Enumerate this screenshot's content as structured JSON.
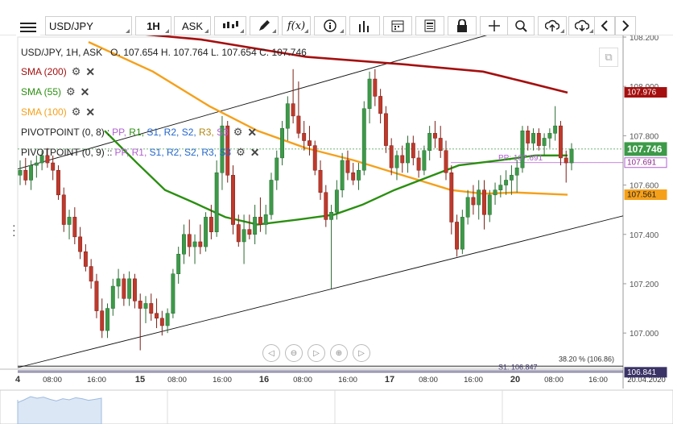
{
  "toolbar": {
    "menu_icon": "hamburger-icon",
    "symbol": "USD/JPY",
    "timeframe": "1H",
    "price_side": "ASK",
    "tools": [
      "candles-icon",
      "pencil-icon",
      "fx-icon",
      "info-icon",
      "bars-icon",
      "calendar-icon",
      "news-icon",
      "lock-icon",
      "crosshair-icon",
      "zoom-icon",
      "upload-icon",
      "download-icon",
      "chevron-left-icon",
      "chevron-right-icon"
    ]
  },
  "header": {
    "symbol_line": "USD/JPY, 1H, ASK",
    "o_label": "O.",
    "o_value": "107.654",
    "h_label": "H.",
    "h_value": "107.764",
    "l_label": "L.",
    "l_value": "107.654",
    "c_label": "C.",
    "c_value": "107.746"
  },
  "indicators": [
    {
      "label": "SMA (200)",
      "color": "#a50f0f"
    },
    {
      "label": "SMA (55)",
      "color": "#2a8f10"
    },
    {
      "label": "SMA (100)",
      "color": "#f5a01a"
    }
  ],
  "pivots": [
    {
      "label": "PIVOTPOINT (0, 8)",
      "sep": ":",
      "levels": [
        {
          "t": "PP",
          "c": "#b05fd0"
        },
        {
          "t": "R1",
          "c": "#2a8f10"
        },
        {
          "t": "S1",
          "c": "#2266cc"
        },
        {
          "t": "R2",
          "c": "#2266cc"
        },
        {
          "t": "S2",
          "c": "#2266cc"
        },
        {
          "t": "R3",
          "c": "#b08810"
        },
        {
          "t": "S3",
          "c": "#b05fd0"
        }
      ]
    },
    {
      "label": "PIVOTPOINT (0, 9)",
      "sep": "::",
      "levels": [
        {
          "t": "PP",
          "c": "#b05fd0"
        },
        {
          "t": "R1",
          "c": "#b05fd0"
        },
        {
          "t": "S1",
          "c": "#2266cc"
        },
        {
          "t": "R2",
          "c": "#2266cc"
        },
        {
          "t": "S2",
          "c": "#2266cc"
        },
        {
          "t": "R3",
          "c": "#2266cc"
        },
        {
          "t": "S3",
          "c": "#2266cc"
        }
      ]
    }
  ],
  "colors": {
    "bull": "#3c9a48",
    "bear": "#c0392b",
    "sma200": "#a50f0f",
    "sma55": "#2a8f10",
    "sma100": "#f5a01a",
    "pivot": "#b05fd0"
  },
  "chart_data": {
    "type": "candlestick",
    "symbol": "USD/JPY",
    "interval": "1H",
    "y_range": [
      106.86,
      108.2
    ],
    "y_ticks": [
      "108.200",
      "108.000",
      "107.800",
      "107.600",
      "107.400",
      "107.200",
      "107.000"
    ],
    "x_ticks": [
      "4",
      "08:00",
      "16:00",
      "15",
      "08:00",
      "16:00",
      "16",
      "08:00",
      "16:00",
      "17",
      "08:00",
      "16:00",
      "20",
      "08:00",
      "16:00",
      "20.04.2020"
    ],
    "last_price": {
      "value": 107.746,
      "label": "107.746",
      "color": "#3c9a48"
    },
    "price_tags": [
      {
        "value": 107.976,
        "label": "107.976",
        "bg": "#a50f0f",
        "fg": "#ffffff"
      },
      {
        "value": 107.691,
        "label": "107.691",
        "bg": "#ffffff",
        "fg": "#8a2a8a",
        "border": "#b05fd0"
      },
      {
        "value": 107.561,
        "label": "107.561",
        "bg": "#f5a01a",
        "fg": "#222222"
      },
      {
        "value": 106.841,
        "label": "106.841",
        "bg": "#3a3366",
        "fg": "#ffffff"
      }
    ],
    "annotations": [
      {
        "text": "PP: 107.691"
      },
      {
        "text": "38.20 % (106.86)"
      },
      {
        "text": "S1: 106.847"
      }
    ],
    "candles": [
      [
        107.64,
        107.7,
        107.6,
        107.66
      ],
      [
        107.66,
        107.71,
        107.6,
        107.62
      ],
      [
        107.62,
        107.7,
        107.58,
        107.68
      ],
      [
        107.68,
        107.72,
        107.63,
        107.69
      ],
      [
        107.69,
        107.74,
        107.66,
        107.72
      ],
      [
        107.72,
        107.75,
        107.67,
        107.69
      ],
      [
        107.69,
        107.72,
        107.62,
        107.66
      ],
      [
        107.66,
        107.68,
        107.54,
        107.56
      ],
      [
        107.56,
        107.59,
        107.41,
        107.44
      ],
      [
        107.44,
        107.5,
        107.38,
        107.47
      ],
      [
        107.47,
        107.51,
        107.36,
        107.39
      ],
      [
        107.39,
        107.43,
        107.3,
        107.33
      ],
      [
        107.33,
        107.36,
        107.25,
        107.27
      ],
      [
        107.27,
        107.3,
        107.18,
        107.21
      ],
      [
        107.21,
        107.24,
        107.06,
        107.09
      ],
      [
        107.09,
        107.14,
        106.98,
        107.01
      ],
      [
        107.01,
        107.12,
        106.98,
        107.1
      ],
      [
        107.1,
        107.22,
        107.07,
        107.19
      ],
      [
        107.19,
        107.26,
        107.14,
        107.22
      ],
      [
        107.22,
        107.24,
        107.11,
        107.14
      ],
      [
        107.14,
        107.25,
        107.11,
        107.22
      ],
      [
        107.22,
        107.24,
        107.1,
        107.13
      ],
      [
        107.13,
        107.16,
        106.93,
        107.1
      ],
      [
        107.1,
        107.15,
        107.04,
        107.12
      ],
      [
        107.12,
        107.16,
        107.05,
        107.08
      ],
      [
        107.08,
        107.14,
        107.02,
        107.06
      ],
      [
        107.06,
        107.09,
        106.99,
        107.03
      ],
      [
        107.03,
        107.1,
        107.0,
        107.08
      ],
      [
        107.08,
        107.26,
        107.06,
        107.24
      ],
      [
        107.24,
        107.35,
        107.2,
        107.32
      ],
      [
        107.32,
        107.44,
        107.28,
        107.4
      ],
      [
        107.4,
        107.46,
        107.31,
        107.35
      ],
      [
        107.35,
        107.4,
        107.28,
        107.37
      ],
      [
        107.37,
        107.44,
        107.32,
        107.35
      ],
      [
        107.35,
        107.49,
        107.33,
        107.47
      ],
      [
        107.47,
        107.52,
        107.38,
        107.41
      ],
      [
        107.41,
        107.7,
        107.39,
        107.65
      ],
      [
        107.65,
        107.88,
        107.58,
        107.84
      ],
      [
        107.84,
        107.86,
        107.61,
        107.64
      ],
      [
        107.64,
        107.68,
        107.4,
        107.44
      ],
      [
        107.44,
        107.48,
        107.35,
        107.37
      ],
      [
        107.37,
        107.48,
        107.28,
        107.42
      ],
      [
        107.42,
        107.48,
        107.38,
        107.4
      ],
      [
        107.4,
        107.52,
        107.36,
        107.47
      ],
      [
        107.47,
        107.55,
        107.41,
        107.44
      ],
      [
        107.44,
        107.52,
        107.4,
        107.48
      ],
      [
        107.48,
        107.65,
        107.46,
        107.62
      ],
      [
        107.62,
        107.74,
        107.58,
        107.71
      ],
      [
        107.71,
        107.86,
        107.68,
        107.83
      ],
      [
        107.83,
        107.96,
        107.78,
        107.93
      ],
      [
        107.93,
        108.07,
        107.85,
        107.88
      ],
      [
        107.88,
        108.02,
        107.79,
        107.81
      ],
      [
        107.81,
        107.86,
        107.74,
        107.78
      ],
      [
        107.78,
        107.84,
        107.72,
        107.76
      ],
      [
        107.76,
        107.78,
        107.64,
        107.66
      ],
      [
        107.66,
        107.7,
        107.54,
        107.57
      ],
      [
        107.57,
        107.6,
        107.43,
        107.46
      ],
      [
        107.46,
        107.52,
        107.18,
        107.49
      ],
      [
        107.49,
        107.62,
        107.46,
        107.58
      ],
      [
        107.58,
        107.73,
        107.55,
        107.7
      ],
      [
        107.7,
        107.74,
        107.62,
        107.65
      ],
      [
        107.65,
        107.69,
        107.6,
        107.62
      ],
      [
        107.62,
        107.69,
        107.58,
        107.66
      ],
      [
        107.66,
        107.94,
        107.64,
        107.91
      ],
      [
        107.91,
        108.06,
        107.85,
        108.03
      ],
      [
        108.03,
        108.07,
        107.92,
        107.96
      ],
      [
        107.96,
        107.99,
        107.85,
        107.89
      ],
      [
        107.89,
        107.92,
        107.73,
        107.76
      ],
      [
        107.76,
        107.79,
        107.64,
        107.67
      ],
      [
        107.67,
        107.74,
        107.62,
        107.72
      ],
      [
        107.72,
        107.76,
        107.65,
        107.69
      ],
      [
        107.69,
        107.8,
        107.65,
        107.77
      ],
      [
        107.77,
        107.8,
        107.68,
        107.71
      ],
      [
        107.71,
        107.74,
        107.63,
        107.66
      ],
      [
        107.66,
        107.76,
        107.64,
        107.74
      ],
      [
        107.74,
        107.84,
        107.7,
        107.81
      ],
      [
        107.81,
        107.86,
        107.75,
        107.79
      ],
      [
        107.79,
        107.84,
        107.71,
        107.74
      ],
      [
        107.74,
        107.78,
        107.62,
        107.65
      ],
      [
        107.65,
        107.68,
        107.4,
        107.45
      ],
      [
        107.45,
        107.48,
        107.31,
        107.34
      ],
      [
        107.34,
        107.5,
        107.32,
        107.47
      ],
      [
        107.47,
        107.58,
        107.44,
        107.55
      ],
      [
        107.55,
        107.6,
        107.48,
        107.52
      ],
      [
        107.52,
        107.62,
        107.46,
        107.58
      ],
      [
        107.58,
        107.62,
        107.42,
        107.48
      ],
      [
        107.48,
        107.58,
        107.45,
        107.56
      ],
      [
        107.56,
        107.61,
        107.52,
        107.58
      ],
      [
        107.58,
        107.64,
        107.55,
        107.6
      ],
      [
        107.6,
        107.66,
        107.56,
        107.62
      ],
      [
        107.62,
        107.68,
        107.56,
        107.64
      ],
      [
        107.64,
        107.7,
        107.57,
        107.67
      ],
      [
        107.67,
        107.84,
        107.65,
        107.82
      ],
      [
        107.82,
        107.84,
        107.74,
        107.77
      ],
      [
        107.77,
        107.83,
        107.74,
        107.81
      ],
      [
        107.81,
        107.83,
        107.74,
        107.76
      ],
      [
        107.76,
        107.81,
        107.72,
        107.79
      ],
      [
        107.79,
        107.83,
        107.75,
        107.81
      ],
      [
        107.81,
        107.92,
        107.78,
        107.84
      ],
      [
        107.84,
        107.86,
        107.68,
        107.71
      ],
      [
        107.71,
        107.74,
        107.61,
        107.69
      ],
      [
        107.69,
        107.77,
        107.66,
        107.746
      ]
    ],
    "x_start_label": "4"
  },
  "nav": [
    "rewind-icon",
    "zoom-out-icon",
    "reset-icon",
    "zoom-in-icon",
    "forward-icon"
  ]
}
